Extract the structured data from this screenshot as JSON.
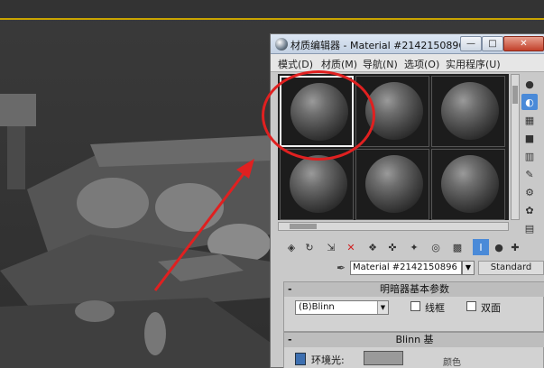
{
  "colors": {
    "accent_red": "#e02020",
    "viewport_bg": "#2e2e2e",
    "selection_blue": "#4a8ad8"
  },
  "viewport": {
    "scene_description_icon": "3d-sofa-scene"
  },
  "material_editor": {
    "title": "材质编辑器 - Material #2142150896",
    "window_buttons": {
      "minimize": "—",
      "maximize": "□",
      "close": "✕"
    },
    "menu": [
      {
        "label": "模式(D)"
      },
      {
        "label": "材质(M)"
      },
      {
        "label": "导航(N)"
      },
      {
        "label": "选项(O)"
      },
      {
        "label": "实用程序(U)"
      }
    ],
    "slots": [
      {
        "active": true
      },
      {
        "active": false
      },
      {
        "active": false
      },
      {
        "active": false
      },
      {
        "active": false
      },
      {
        "active": false
      }
    ],
    "side_tools": [
      {
        "icon": "sample-type-icon",
        "glyph": "●"
      },
      {
        "icon": "backlight-icon",
        "glyph": "◐"
      },
      {
        "icon": "background-icon",
        "glyph": "▦"
      },
      {
        "icon": "sample-uv-tiling-icon",
        "glyph": "■"
      },
      {
        "icon": "video-color-check-icon",
        "glyph": "▥"
      },
      {
        "icon": "make-preview-icon",
        "glyph": "✎"
      },
      {
        "icon": "options-icon",
        "glyph": "⚙"
      },
      {
        "icon": "select-by-material-icon",
        "glyph": "✿"
      },
      {
        "icon": "material-map-navigator-icon",
        "glyph": "▤"
      }
    ],
    "bottom_tools": [
      {
        "icon": "get-material-icon",
        "glyph": "◈"
      },
      {
        "icon": "put-to-scene-icon",
        "glyph": "↻"
      },
      {
        "icon": "assign-to-selection-icon",
        "glyph": "⇲"
      },
      {
        "icon": "reset-map-icon",
        "glyph": "✕"
      },
      {
        "icon": "make-copy-icon",
        "glyph": "❖"
      },
      {
        "icon": "make-unique-icon",
        "glyph": "✜"
      },
      {
        "icon": "put-to-library-icon",
        "glyph": "✦"
      },
      {
        "icon": "material-id-channel-icon",
        "glyph": "◎"
      },
      {
        "icon": "show-shaded-in-viewport-icon",
        "glyph": "▩"
      },
      {
        "icon": "show-end-result-icon",
        "glyph": "I"
      },
      {
        "icon": "go-to-parent-icon",
        "glyph": "●"
      },
      {
        "icon": "go-forward-to-sibling-icon",
        "glyph": "✚"
      }
    ],
    "material_name": "Material #2142150896",
    "material_type": "Standard",
    "shader_rollout": {
      "toggle": "-",
      "title": "明暗器基本参数",
      "shader": "(B)Blinn",
      "wire_label": "线框",
      "two_sided_label": "双面"
    },
    "blinn_rollout": {
      "toggle": "-",
      "title": "Blinn 基",
      "ambient_label": "环境光:",
      "color_label": "颜色"
    }
  }
}
